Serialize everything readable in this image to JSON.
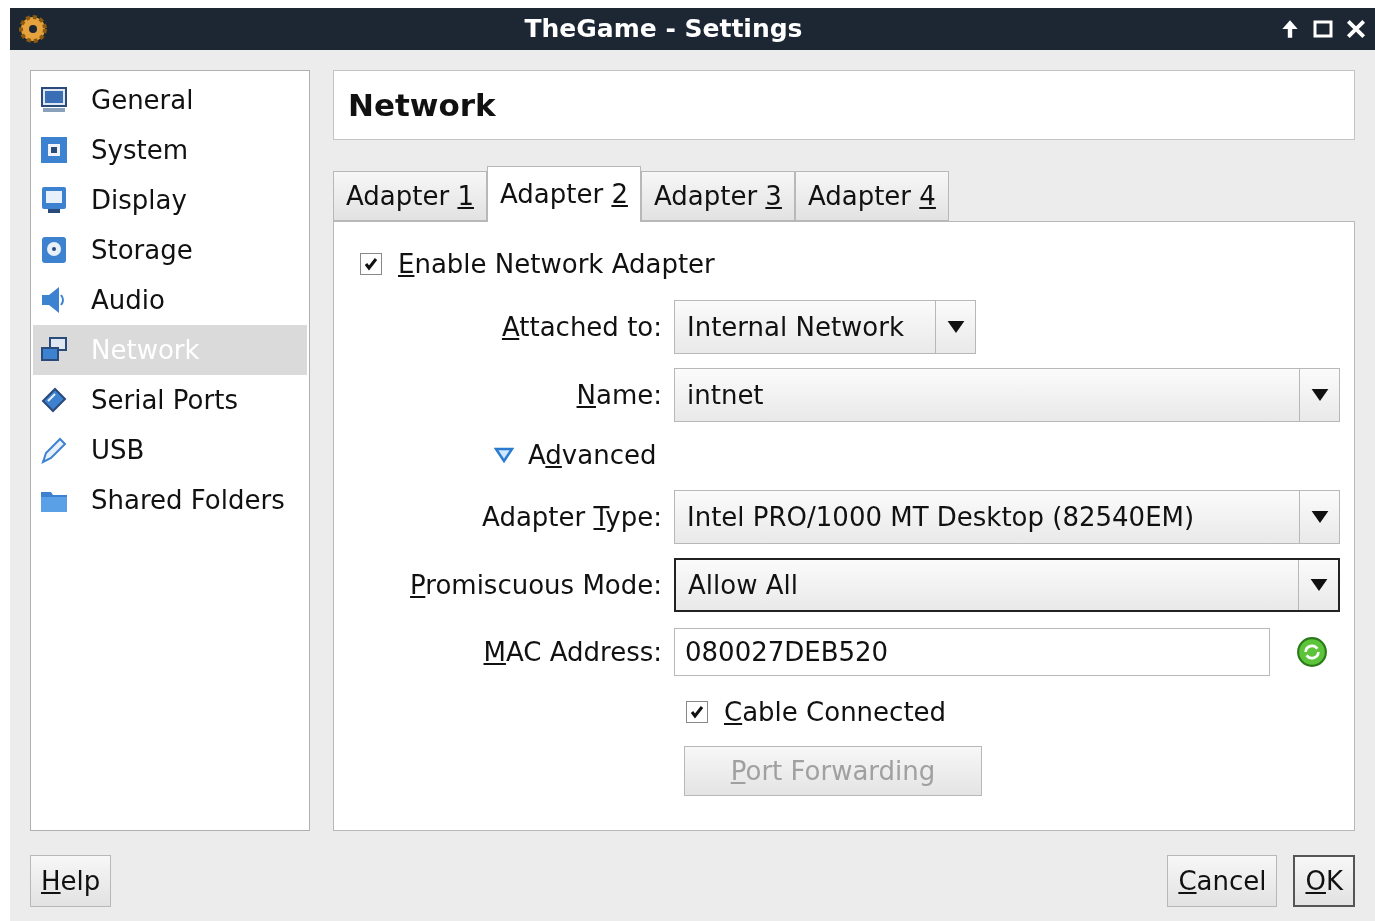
{
  "window": {
    "title": "TheGame - Settings"
  },
  "sidebar": {
    "items": [
      {
        "label": "General",
        "selected": false
      },
      {
        "label": "System",
        "selected": false
      },
      {
        "label": "Display",
        "selected": false
      },
      {
        "label": "Storage",
        "selected": false
      },
      {
        "label": "Audio",
        "selected": false
      },
      {
        "label": "Network",
        "selected": true
      },
      {
        "label": "Serial Ports",
        "selected": false
      },
      {
        "label": "USB",
        "selected": false
      },
      {
        "label": "Shared Folders",
        "selected": false
      }
    ]
  },
  "page_title": "Network",
  "tabs": [
    {
      "label": {
        "before": "Adapter ",
        "mnemonic": "1"
      },
      "selected": false
    },
    {
      "label": {
        "before": "Adapter ",
        "mnemonic": "2"
      },
      "selected": true
    },
    {
      "label": {
        "before": "Adapter ",
        "mnemonic": "3"
      },
      "selected": false
    },
    {
      "label": {
        "before": "Adapter ",
        "mnemonic": "4"
      },
      "selected": false
    }
  ],
  "enable_adapter": {
    "label": {
      "mnemonic": "E",
      "after": "nable Network Adapter"
    },
    "checked": true
  },
  "attached_to": {
    "label": {
      "mnemonic": "A",
      "after": "ttached to:"
    },
    "value": "Internal Network"
  },
  "name": {
    "label": {
      "mnemonic": "N",
      "after": "ame:"
    },
    "value": "intnet"
  },
  "advanced": {
    "label": {
      "before": "A",
      "mnemonic": "d",
      "after": "vanced"
    },
    "expanded": true
  },
  "adapter_type": {
    "label": {
      "before": "Adapter ",
      "mnemonic": "T",
      "after": "ype:"
    },
    "value": "Intel PRO/1000 MT Desktop (82540EM)"
  },
  "promiscuous_mode": {
    "label": {
      "mnemonic": "P",
      "after": "romiscuous Mode:"
    },
    "value": "Allow All",
    "focused": true
  },
  "mac_address": {
    "label": {
      "mnemonic": "M",
      "after": "AC Address:"
    },
    "value": "080027DEB520"
  },
  "cable_connected": {
    "label": {
      "mnemonic": "C",
      "after": "able Connected"
    },
    "checked": true
  },
  "port_forwarding": {
    "label": {
      "mnemonic": "P",
      "after": "ort Forwarding"
    },
    "disabled": true
  },
  "help_button": {
    "label": {
      "mnemonic": "H",
      "after": "elp"
    }
  },
  "dialog_buttons": [
    {
      "label": {
        "mnemonic": "C",
        "after": "ancel"
      },
      "default": false
    },
    {
      "label": {
        "mnemonic": "O",
        "after": "K"
      },
      "default": true
    }
  ]
}
